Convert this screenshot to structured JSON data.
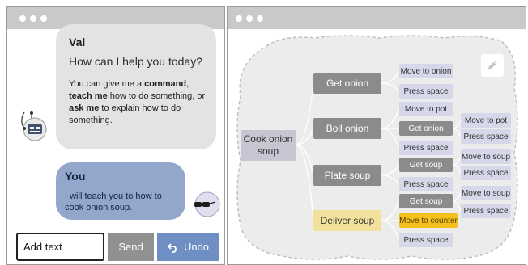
{
  "chat": {
    "agent_name": "Val",
    "greeting": "How can I help you today?",
    "help": {
      "p1": "You can give me a ",
      "b1": "command",
      "p2": ", ",
      "b2": "teach me",
      "p3": " how to do something, or ",
      "b3": "ask me",
      "p4": " to explain how to do something."
    },
    "user_name": "You",
    "user_message": "I will teach you to how to cook onion soup."
  },
  "input": {
    "placeholder": "Add text"
  },
  "buttons": {
    "send": "Send",
    "undo": "Undo"
  },
  "icons": {
    "robot": "robot-avatar-icon",
    "user": "user-avatar-icon",
    "undo": "undo-arrow-icon",
    "edit": "pencil-icon"
  },
  "colors": {
    "agent_bubble": "#e3e3e3",
    "user_bubble": "#93a6cc",
    "send_button": "#919191",
    "undo_button": "#6f8fc4",
    "highlight_action": "#f4c11c",
    "current_step": "#f1e19a"
  },
  "task_tree": {
    "root": "Cook onion soup",
    "subtasks": {
      "get_onion": "Get onion",
      "boil_onion": "Boil onion",
      "plate_soup": "Plate soup",
      "deliver_soup": "Deliver soup"
    },
    "actions": {
      "get_onion": [
        "Move to onion",
        "Press space"
      ],
      "boil_onion": [
        "Move to pot",
        "Get onion",
        "Press space"
      ],
      "boil_get_onion": [
        "Move to pot",
        "Press space"
      ],
      "plate_soup": [
        "Get soup",
        "Press space"
      ],
      "plate_get_soup": [
        "Move to soup",
        "Press space"
      ],
      "deliver_soup": [
        "Get soup",
        "Move to counter",
        "Press space"
      ],
      "deliver_get_soup": [
        "Move to soup",
        "Press space"
      ]
    }
  }
}
